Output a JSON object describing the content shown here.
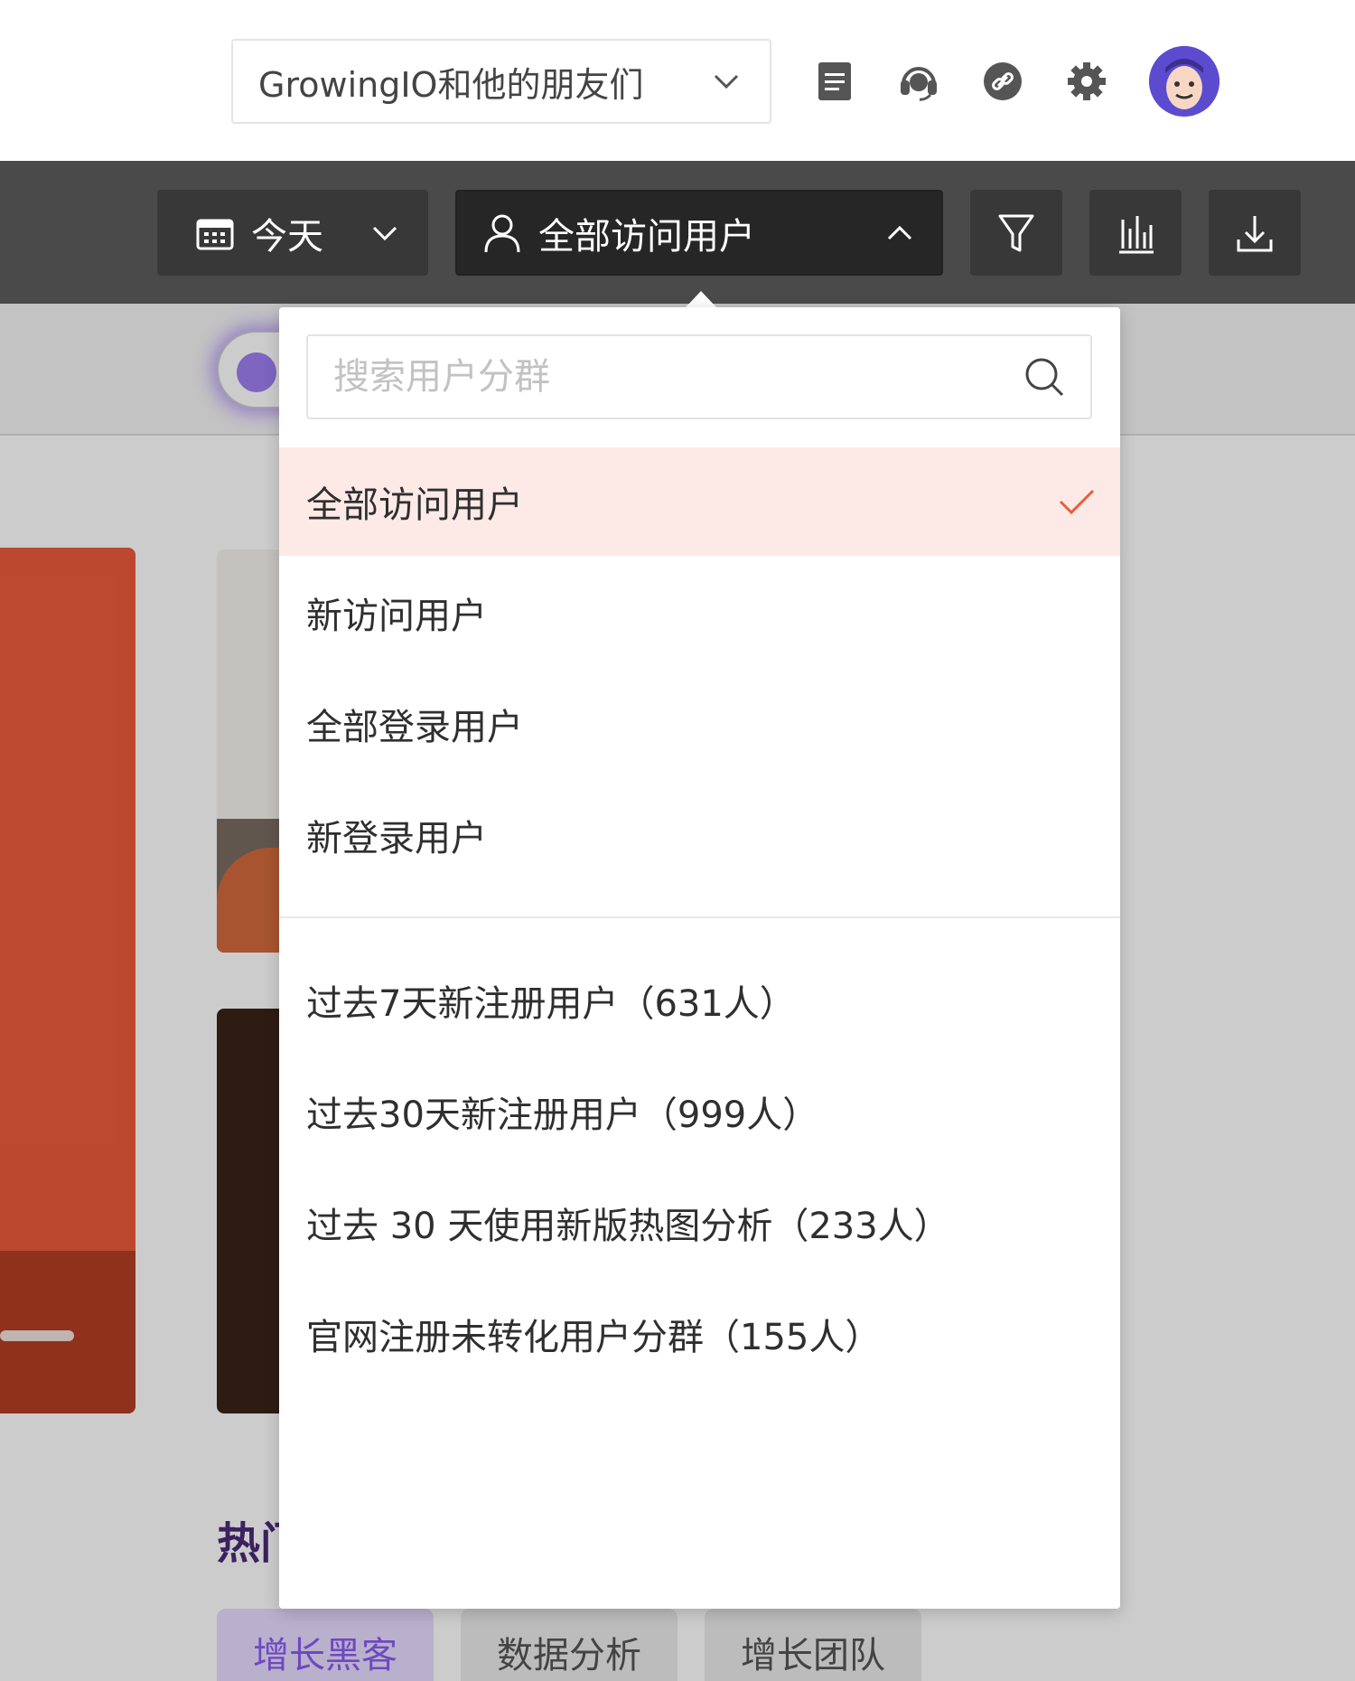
{
  "header": {
    "project_name": "GrowingIO和他的朋友们",
    "icons": [
      "document-icon",
      "headset-icon",
      "link-icon",
      "gear-icon"
    ],
    "avatar": "user-avatar"
  },
  "toolbar": {
    "date_label": "今天",
    "segment_label": "全部访问用户",
    "buttons": [
      "filter-icon",
      "chart-icon",
      "download-icon"
    ]
  },
  "dropdown": {
    "search_placeholder": "搜索用户分群",
    "preset_items": [
      {
        "label": "全部访问用户",
        "selected": true
      },
      {
        "label": "新访问用户",
        "selected": false
      },
      {
        "label": "全部登录用户",
        "selected": false
      },
      {
        "label": "新登录用户",
        "selected": false
      }
    ],
    "custom_items": [
      {
        "label": "过去7天新注册用户（631人）"
      },
      {
        "label": "过去30天新注册用户（999人）"
      },
      {
        "label": "过去 30 天使用新版热图分析（233人）"
      },
      {
        "label": "官网注册未转化用户分群（155人）"
      }
    ]
  },
  "background": {
    "hot_title": "热门",
    "tags": [
      "增长黑客",
      "数据分析",
      "增长团队"
    ]
  },
  "colors": {
    "accent": "#ec5b3c",
    "selected_bg": "#fdeae6",
    "toolbar_bg": "#4a4a4a",
    "purple": "#8a5cf0"
  }
}
